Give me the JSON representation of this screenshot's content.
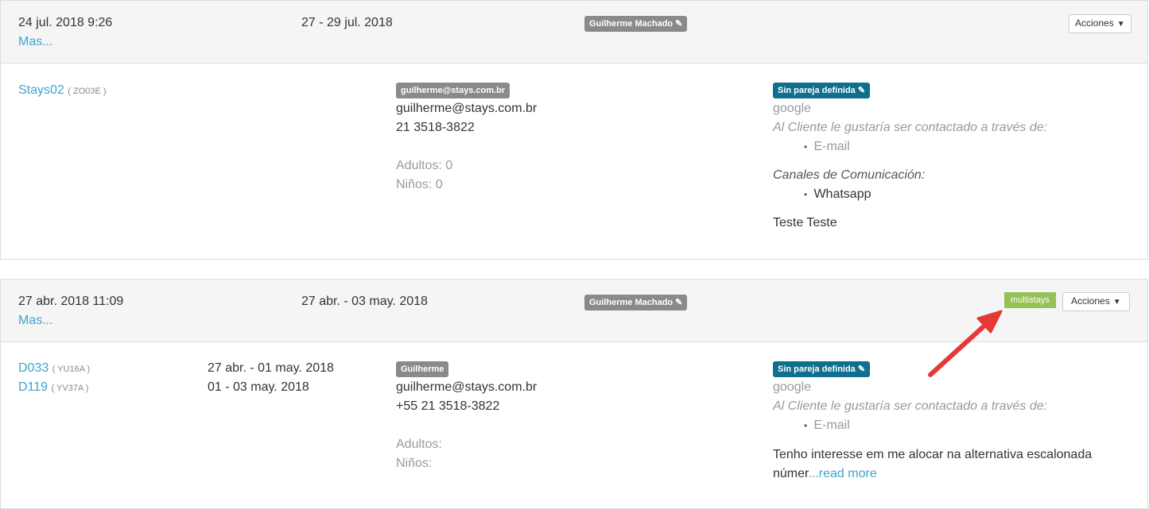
{
  "bookings": [
    {
      "created": "24 jul. 2018 9:26",
      "more": "Mas...",
      "dates": "27 - 29 jul. 2018",
      "agent": "Guilherme Machado",
      "actions": "Acciones",
      "listings": [
        {
          "name": "Stays02",
          "code": "( ZO03E )"
        }
      ],
      "contact_badge": "guilherme@stays.com.br",
      "email": "guilherme@stays.com.br",
      "phone": "21 3518-3822",
      "adults": "Adultos: 0",
      "children": "Niños: 0",
      "partner": "Sin pareja definida",
      "source": "google",
      "contact_pref_title": "Al Cliente le gustaría ser contactado a través de:",
      "contact_pref": "E-mail",
      "channels_title": "Canales de Comunicación:",
      "channel": "Whatsapp",
      "note": "Teste Teste"
    },
    {
      "created": "27 abr. 2018 11:09",
      "more": "Mas...",
      "dates": "27 abr. - 03 may. 2018",
      "agent": "Guilherme Machado",
      "tag": "multistays",
      "actions": "Acciones",
      "listings": [
        {
          "name": "D033",
          "code": "( YU16A )",
          "dates": "27 abr. - 01 may. 2018"
        },
        {
          "name": "D119",
          "code": "( YV37A )",
          "dates": "01 - 03 may. 2018"
        }
      ],
      "contact_badge": "Guilherme",
      "email": "guilherme@stays.com.br",
      "phone": "+55 21 3518-3822",
      "adults": "Adultos:",
      "children": "Niños:",
      "partner": "Sin pareja definida",
      "source": "google",
      "contact_pref_title": "Al Cliente le gustaría ser contactado a través de:",
      "contact_pref": "E-mail",
      "note_line1": "Tenho interesse em me alocar na alternativa escalonada",
      "note_line2": "númer",
      "read_more": "...read more"
    }
  ],
  "colors": {
    "link": "#3ea3cf",
    "label_gray": "#8a8a8a",
    "label_blue": "#0e6f8e",
    "multistays_green": "#95c157",
    "arrow_red": "#e53935"
  },
  "icons": {
    "edit": "pencil-icon",
    "dropdown": "caret-down-icon",
    "annotation": "red-arrow"
  }
}
